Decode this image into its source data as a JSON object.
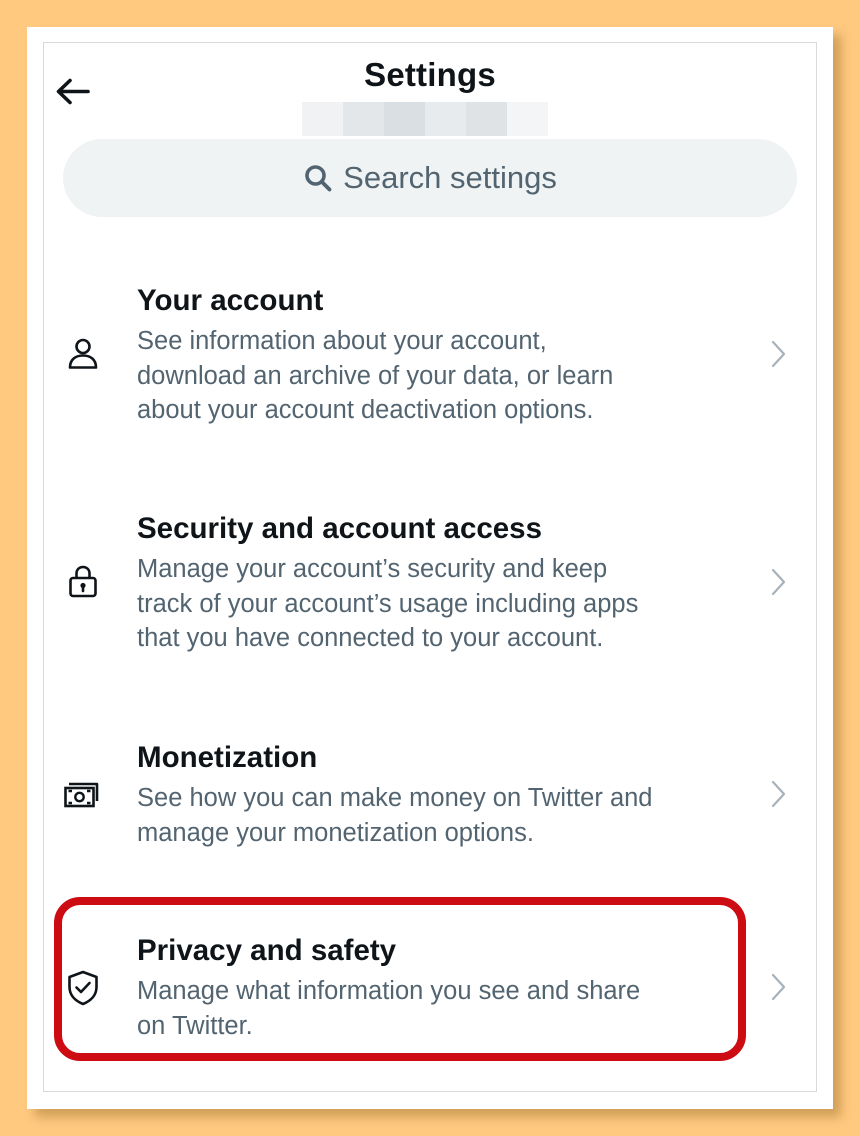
{
  "header": {
    "title": "Settings",
    "back_icon": "back-arrow-icon"
  },
  "search": {
    "placeholder": "Search settings",
    "icon": "search-icon"
  },
  "items": [
    {
      "icon": "person-icon",
      "title": "Your account",
      "description_lines": [
        "See information about your account,",
        "download an archive of your data, or learn",
        "about your account deactivation options."
      ]
    },
    {
      "icon": "lock-icon",
      "title": "Security and account access",
      "description_lines": [
        "Manage your account’s security and keep",
        "track of your account’s usage including apps",
        "that you have connected to your account."
      ]
    },
    {
      "icon": "money-icon",
      "title": "Monetization",
      "description_lines": [
        "See how you can make money on Twitter and",
        "manage your monetization options."
      ]
    },
    {
      "icon": "shield-check-icon",
      "title": "Privacy and safety",
      "description_lines": [
        "Manage what information you see and share",
        "on Twitter."
      ],
      "highlighted": true
    }
  ],
  "colors": {
    "background": "#FFC97F",
    "text_primary": "#0f1419",
    "text_secondary": "#536471",
    "search_bg": "#eff3f4",
    "highlight": "#cc0b12"
  }
}
